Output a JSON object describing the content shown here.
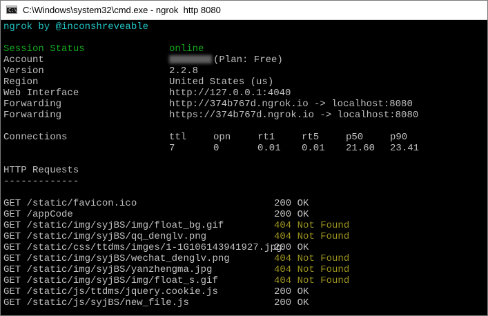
{
  "window": {
    "title": "C:\\Windows\\system32\\cmd.exe - ngrok  http 8080"
  },
  "header": {
    "banner": "ngrok by @inconshreveable"
  },
  "session": {
    "status_label": "Session Status",
    "status_value": "online",
    "account_label": "Account",
    "account_value": "(Plan: Free)",
    "version_label": "Version",
    "version_value": "2.2.8",
    "region_label": "Region",
    "region_value": "United States (us)",
    "web_interface_label": "Web Interface",
    "web_interface_value": "http://127.0.0.1:4040",
    "forwarding_label": "Forwarding",
    "forwarding_http": "http://374b767d.ngrok.io -> localhost:8080",
    "forwarding_https": "https://374b767d.ngrok.io -> localhost:8080"
  },
  "connections": {
    "label": "Connections",
    "columns": [
      "ttl",
      "opn",
      "rt1",
      "rt5",
      "p50",
      "p90"
    ],
    "values": [
      "7",
      "0",
      "0.01",
      "0.01",
      "21.60",
      "23.41"
    ]
  },
  "http_requests": {
    "title": "HTTP Requests",
    "underline": "-------------",
    "rows": [
      {
        "request": "GET /static/favicon.ico",
        "status": "200 OK",
        "ok": true
      },
      {
        "request": "GET /appCode",
        "status": "200 OK",
        "ok": true
      },
      {
        "request": "GET /static/img/syjBS/img/float_bg.gif",
        "status": "404 Not Found",
        "ok": false
      },
      {
        "request": "GET /static/img/syjBS/qq_denglv.png",
        "status": "404 Not Found",
        "ok": false
      },
      {
        "request": "GET /static/css/ttdms/imges/1-1G106143941927.jpg",
        "status": "200 OK",
        "ok": true
      },
      {
        "request": "GET /static/img/syjBS/wechat_denglv.png",
        "status": "404 Not Found",
        "ok": false
      },
      {
        "request": "GET /static/img/syjBS/yanzhengma.jpg",
        "status": "404 Not Found",
        "ok": false
      },
      {
        "request": "GET /static/img/syjBS/img/float_s.gif",
        "status": "404 Not Found",
        "ok": false
      },
      {
        "request": "GET /static/js/ttdms/jquery.cookie.js",
        "status": "200 OK",
        "ok": true
      },
      {
        "request": "GET /static/js/syjBS/new_file.js",
        "status": "200 OK",
        "ok": true
      }
    ]
  },
  "colors": {
    "background": "#000000",
    "text": "#c0c0c0",
    "banner": "#22c4c4",
    "online": "#15a81f",
    "not_found": "#9c9320"
  }
}
